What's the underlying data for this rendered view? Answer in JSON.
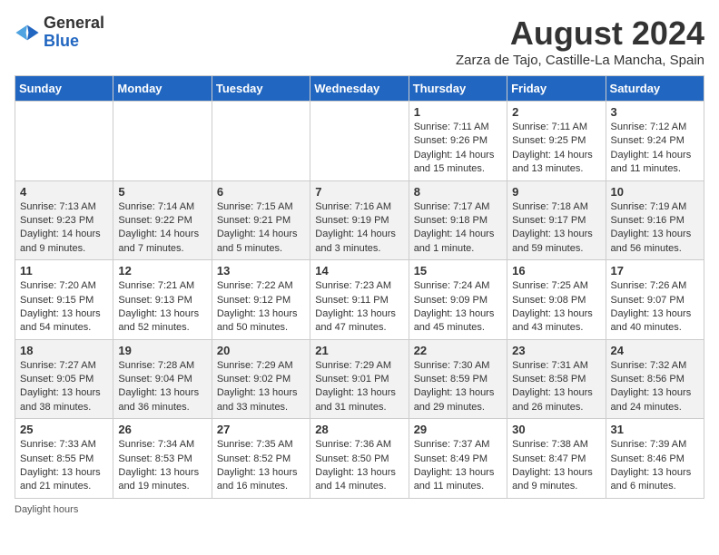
{
  "header": {
    "logo_line1": "General",
    "logo_line2": "Blue",
    "month_title": "August 2024",
    "subtitle": "Zarza de Tajo, Castille-La Mancha, Spain"
  },
  "days_of_week": [
    "Sunday",
    "Monday",
    "Tuesday",
    "Wednesday",
    "Thursday",
    "Friday",
    "Saturday"
  ],
  "weeks": [
    [
      {
        "day": "",
        "info": ""
      },
      {
        "day": "",
        "info": ""
      },
      {
        "day": "",
        "info": ""
      },
      {
        "day": "",
        "info": ""
      },
      {
        "day": "1",
        "info": "Sunrise: 7:11 AM\nSunset: 9:26 PM\nDaylight: 14 hours and 15 minutes."
      },
      {
        "day": "2",
        "info": "Sunrise: 7:11 AM\nSunset: 9:25 PM\nDaylight: 14 hours and 13 minutes."
      },
      {
        "day": "3",
        "info": "Sunrise: 7:12 AM\nSunset: 9:24 PM\nDaylight: 14 hours and 11 minutes."
      }
    ],
    [
      {
        "day": "4",
        "info": "Sunrise: 7:13 AM\nSunset: 9:23 PM\nDaylight: 14 hours and 9 minutes."
      },
      {
        "day": "5",
        "info": "Sunrise: 7:14 AM\nSunset: 9:22 PM\nDaylight: 14 hours and 7 minutes."
      },
      {
        "day": "6",
        "info": "Sunrise: 7:15 AM\nSunset: 9:21 PM\nDaylight: 14 hours and 5 minutes."
      },
      {
        "day": "7",
        "info": "Sunrise: 7:16 AM\nSunset: 9:19 PM\nDaylight: 14 hours and 3 minutes."
      },
      {
        "day": "8",
        "info": "Sunrise: 7:17 AM\nSunset: 9:18 PM\nDaylight: 14 hours and 1 minute."
      },
      {
        "day": "9",
        "info": "Sunrise: 7:18 AM\nSunset: 9:17 PM\nDaylight: 13 hours and 59 minutes."
      },
      {
        "day": "10",
        "info": "Sunrise: 7:19 AM\nSunset: 9:16 PM\nDaylight: 13 hours and 56 minutes."
      }
    ],
    [
      {
        "day": "11",
        "info": "Sunrise: 7:20 AM\nSunset: 9:15 PM\nDaylight: 13 hours and 54 minutes."
      },
      {
        "day": "12",
        "info": "Sunrise: 7:21 AM\nSunset: 9:13 PM\nDaylight: 13 hours and 52 minutes."
      },
      {
        "day": "13",
        "info": "Sunrise: 7:22 AM\nSunset: 9:12 PM\nDaylight: 13 hours and 50 minutes."
      },
      {
        "day": "14",
        "info": "Sunrise: 7:23 AM\nSunset: 9:11 PM\nDaylight: 13 hours and 47 minutes."
      },
      {
        "day": "15",
        "info": "Sunrise: 7:24 AM\nSunset: 9:09 PM\nDaylight: 13 hours and 45 minutes."
      },
      {
        "day": "16",
        "info": "Sunrise: 7:25 AM\nSunset: 9:08 PM\nDaylight: 13 hours and 43 minutes."
      },
      {
        "day": "17",
        "info": "Sunrise: 7:26 AM\nSunset: 9:07 PM\nDaylight: 13 hours and 40 minutes."
      }
    ],
    [
      {
        "day": "18",
        "info": "Sunrise: 7:27 AM\nSunset: 9:05 PM\nDaylight: 13 hours and 38 minutes."
      },
      {
        "day": "19",
        "info": "Sunrise: 7:28 AM\nSunset: 9:04 PM\nDaylight: 13 hours and 36 minutes."
      },
      {
        "day": "20",
        "info": "Sunrise: 7:29 AM\nSunset: 9:02 PM\nDaylight: 13 hours and 33 minutes."
      },
      {
        "day": "21",
        "info": "Sunrise: 7:29 AM\nSunset: 9:01 PM\nDaylight: 13 hours and 31 minutes."
      },
      {
        "day": "22",
        "info": "Sunrise: 7:30 AM\nSunset: 8:59 PM\nDaylight: 13 hours and 29 minutes."
      },
      {
        "day": "23",
        "info": "Sunrise: 7:31 AM\nSunset: 8:58 PM\nDaylight: 13 hours and 26 minutes."
      },
      {
        "day": "24",
        "info": "Sunrise: 7:32 AM\nSunset: 8:56 PM\nDaylight: 13 hours and 24 minutes."
      }
    ],
    [
      {
        "day": "25",
        "info": "Sunrise: 7:33 AM\nSunset: 8:55 PM\nDaylight: 13 hours and 21 minutes."
      },
      {
        "day": "26",
        "info": "Sunrise: 7:34 AM\nSunset: 8:53 PM\nDaylight: 13 hours and 19 minutes."
      },
      {
        "day": "27",
        "info": "Sunrise: 7:35 AM\nSunset: 8:52 PM\nDaylight: 13 hours and 16 minutes."
      },
      {
        "day": "28",
        "info": "Sunrise: 7:36 AM\nSunset: 8:50 PM\nDaylight: 13 hours and 14 minutes."
      },
      {
        "day": "29",
        "info": "Sunrise: 7:37 AM\nSunset: 8:49 PM\nDaylight: 13 hours and 11 minutes."
      },
      {
        "day": "30",
        "info": "Sunrise: 7:38 AM\nSunset: 8:47 PM\nDaylight: 13 hours and 9 minutes."
      },
      {
        "day": "31",
        "info": "Sunrise: 7:39 AM\nSunset: 8:46 PM\nDaylight: 13 hours and 6 minutes."
      }
    ]
  ],
  "footer": {
    "daylight_label": "Daylight hours"
  }
}
